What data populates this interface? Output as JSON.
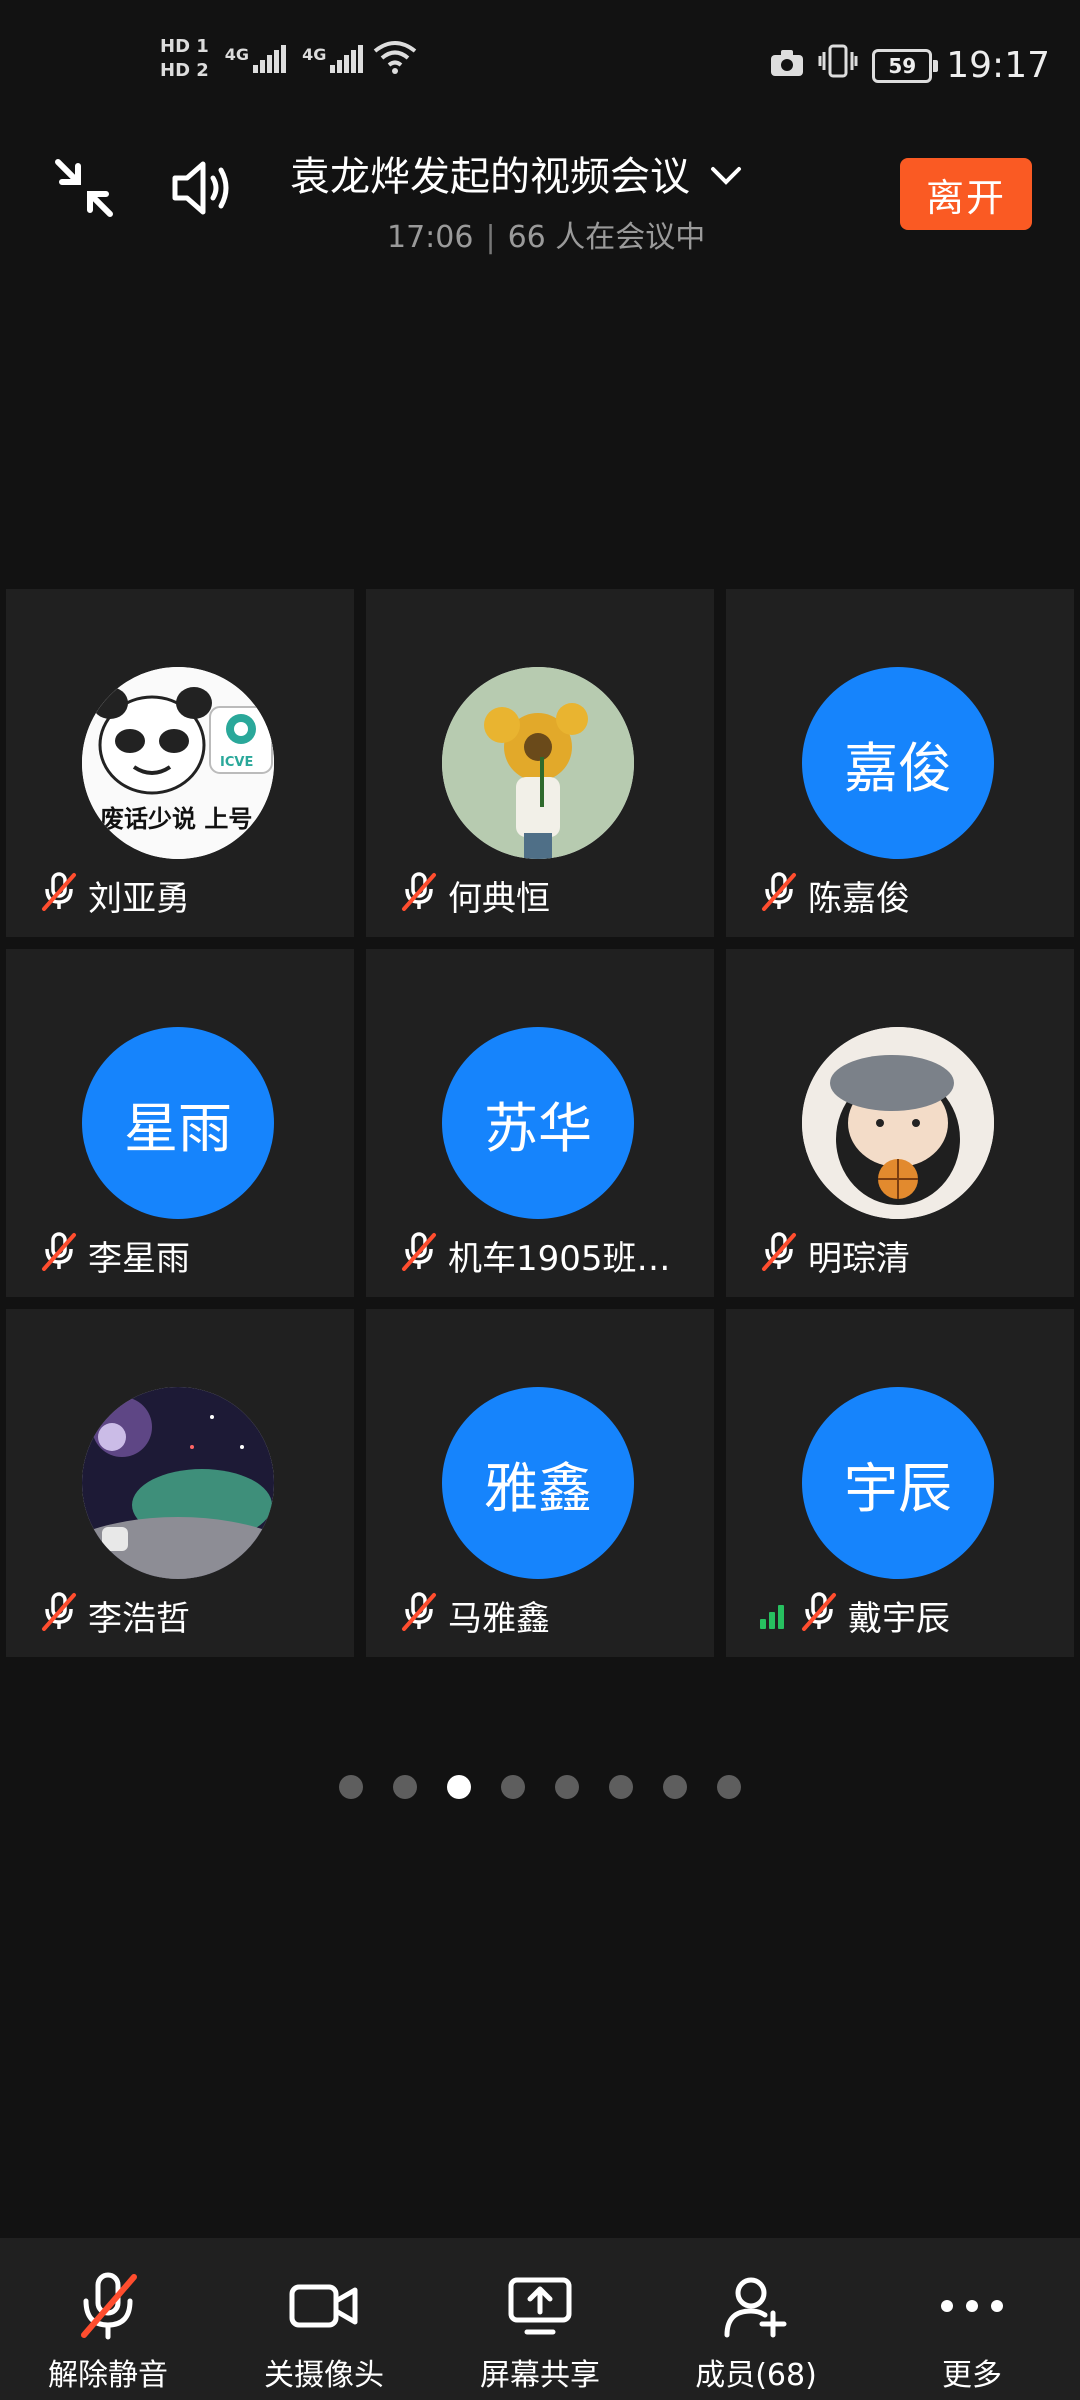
{
  "status_bar": {
    "sim1": "HD 1",
    "sim2": "HD 2",
    "net1": "4G",
    "net2": "4G",
    "battery": "59",
    "time": "19:17"
  },
  "header": {
    "title": "袁龙烨发起的视频会议",
    "start_time": "17:06",
    "separator": "|",
    "participants_text": "66 人在会议中",
    "leave_label": "离开"
  },
  "participants": [
    {
      "name": "刘亚勇",
      "avatar_text": "",
      "avatar_caption": "废话少说 上号",
      "avatar_badge": "ICVE",
      "avatar_type": "image-panda-meme",
      "muted": true
    },
    {
      "name": "何典恒",
      "avatar_text": "",
      "avatar_type": "image-sunflower-figure",
      "muted": true
    },
    {
      "name": "陈嘉俊",
      "avatar_text": "嘉俊",
      "avatar_type": "initials",
      "muted": true
    },
    {
      "name": "李星雨",
      "avatar_text": "星雨",
      "avatar_type": "initials",
      "muted": true
    },
    {
      "name": "机车1905班…",
      "avatar_text": "苏华",
      "avatar_type": "initials",
      "muted": true
    },
    {
      "name": "明琮清",
      "avatar_text": "",
      "avatar_type": "image-felt-doll",
      "muted": true
    },
    {
      "name": "李浩哲",
      "avatar_text": "",
      "avatar_type": "image-astronaut-moon",
      "muted": true
    },
    {
      "name": "马雅鑫",
      "avatar_text": "雅鑫",
      "avatar_type": "initials",
      "muted": true
    },
    {
      "name": "戴宇辰",
      "avatar_text": "宇辰",
      "avatar_type": "initials",
      "muted": true,
      "speaking_signal": true
    }
  ],
  "pagination": {
    "total": 8,
    "active_index": 2
  },
  "toolbar": {
    "unmute_label": "解除静音",
    "camera_label": "关摄像头",
    "share_label": "屏幕共享",
    "members_label": "成员(68)",
    "more_label": "更多"
  },
  "colors": {
    "background": "#121212",
    "tile": "#202020",
    "avatar_blue": "#1684fc",
    "leave_orange": "#fa5a23",
    "mute_slash": "#ff4d2e",
    "signal_green": "#27c060"
  },
  "icons": {
    "minimize": "minimize-arrows-icon",
    "speaker": "speaker-icon",
    "dropdown": "chevron-down-icon",
    "mic_off": "mic-off-icon",
    "camera": "video-camera-icon",
    "share": "screen-share-icon",
    "members": "add-member-icon",
    "more": "more-dots-icon"
  }
}
